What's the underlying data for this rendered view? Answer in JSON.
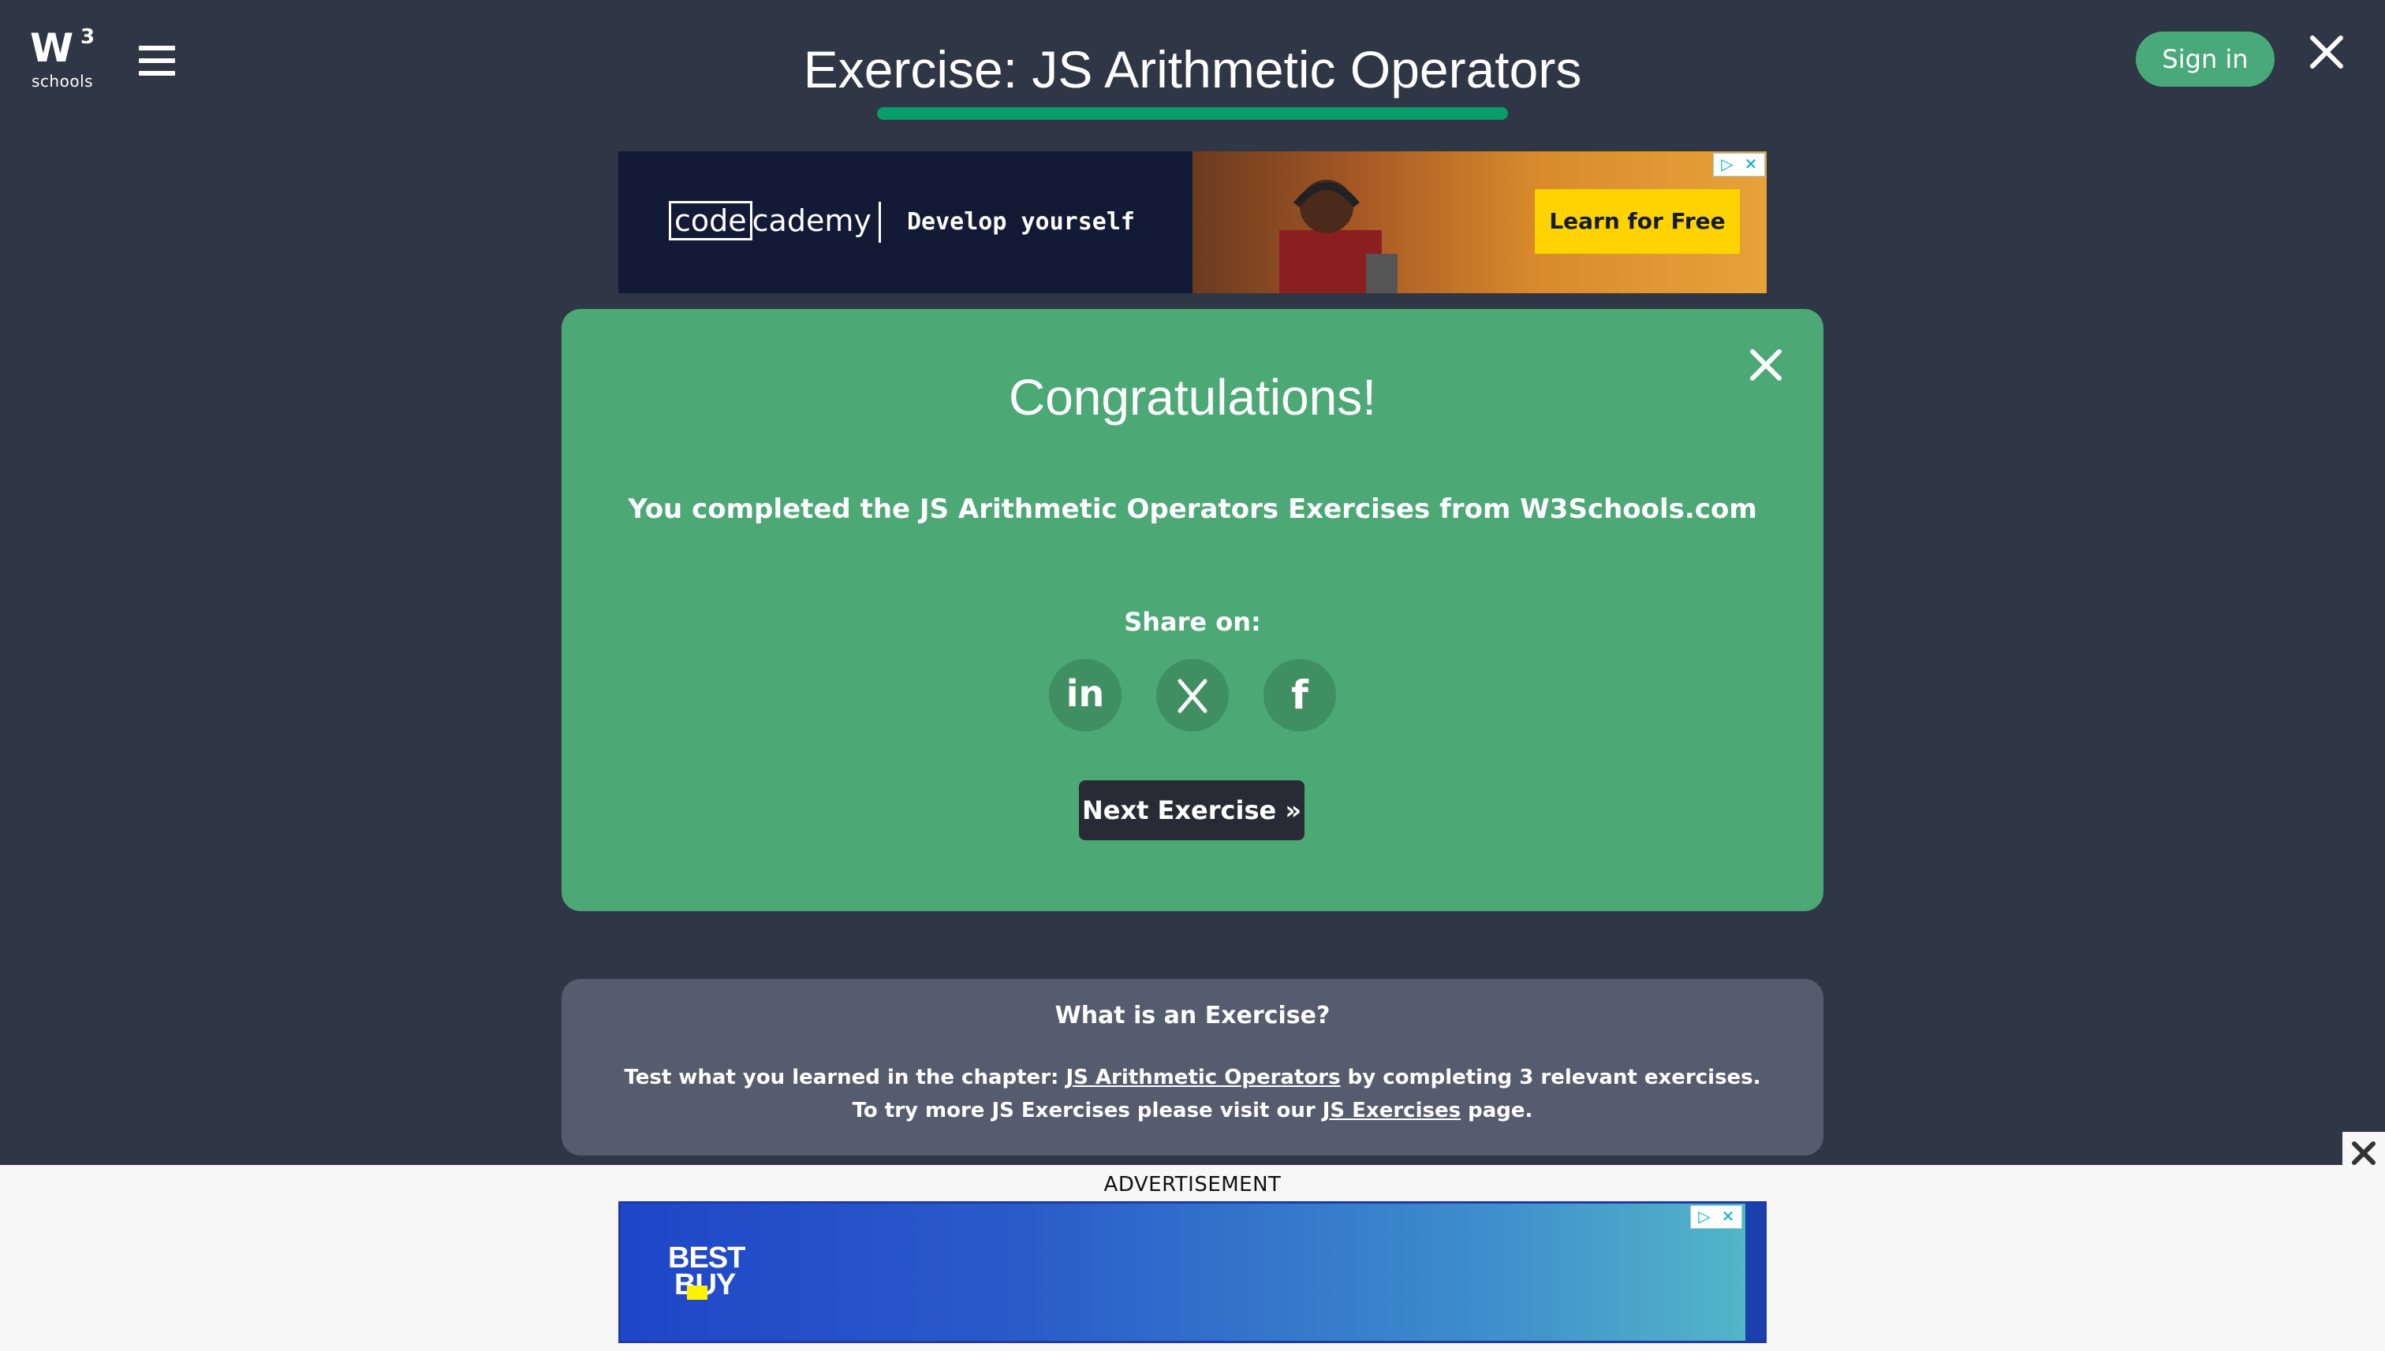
{
  "header": {
    "logo_mark": "W",
    "logo_super": "3",
    "logo_text": "schools",
    "title": "Exercise: JS Arithmetic Operators",
    "signin_label": "Sign in"
  },
  "top_ad": {
    "brand_code": "code",
    "brand_rest": "cademy",
    "tagline": "Develop yourself",
    "cta": "Learn for Free"
  },
  "congrats_panel": {
    "heading": "Congratulations!",
    "message": "You completed the JS Arithmetic Operators Exercises from W3Schools.com",
    "share_label": "Share on:",
    "share_buttons": [
      {
        "icon": "linkedin-icon",
        "glyph": "in"
      },
      {
        "icon": "x-icon",
        "glyph": "𝕏"
      },
      {
        "icon": "facebook-icon",
        "glyph": "f"
      }
    ],
    "next_button": "Next Exercise »"
  },
  "info_box": {
    "title": "What is an Exercise?",
    "line1_pre": "Test what you learned in the chapter: ",
    "line1_link": "JS Arithmetic Operators",
    "line1_post": " by completing 3 relevant exercises.",
    "line2_pre": "To try more JS Exercises please visit our ",
    "line2_link": "JS Exercises",
    "line2_post": " page."
  },
  "bottom_ad": {
    "label": "ADVERTISEMENT",
    "brand_line1": "BEST",
    "brand_line2": "BUY"
  },
  "colors": {
    "page_bg": "#2f3646",
    "panel_green": "#4ca874",
    "accent_green": "#04aa6d",
    "info_bg": "#555c6e",
    "button_dark": "#282a35"
  }
}
